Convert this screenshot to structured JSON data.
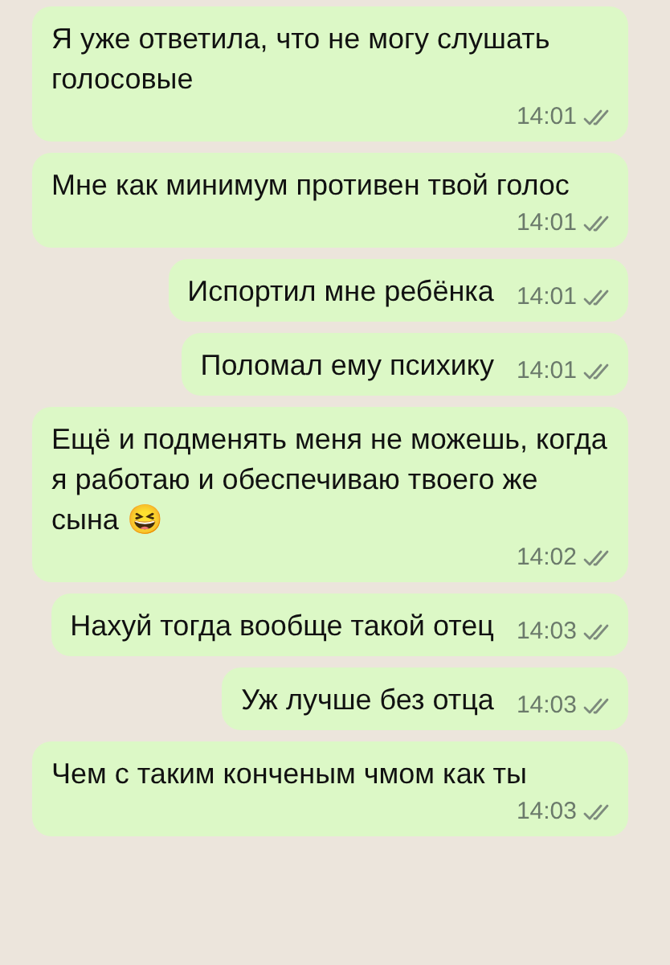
{
  "messages": [
    {
      "text": "Я уже ответила, что не могу слушать голосовые",
      "time": "14:01"
    },
    {
      "text": "Мне как минимум противен твой голос",
      "time": "14:01"
    },
    {
      "text": "Испортил мне ребёнка",
      "time": "14:01"
    },
    {
      "text": "Поломал ему психику",
      "time": "14:01"
    },
    {
      "text": "Ещё и подменять меня не можешь, когда я работаю и обеспечиваю твоего же сына 😆",
      "time": "14:02"
    },
    {
      "text": "Нахуй тогда вообще такой отец",
      "time": "14:03"
    },
    {
      "text": "Уж лучше без отца",
      "time": "14:03"
    },
    {
      "text": "Чем с таким конченым чмом как ты",
      "time": "14:03"
    }
  ]
}
